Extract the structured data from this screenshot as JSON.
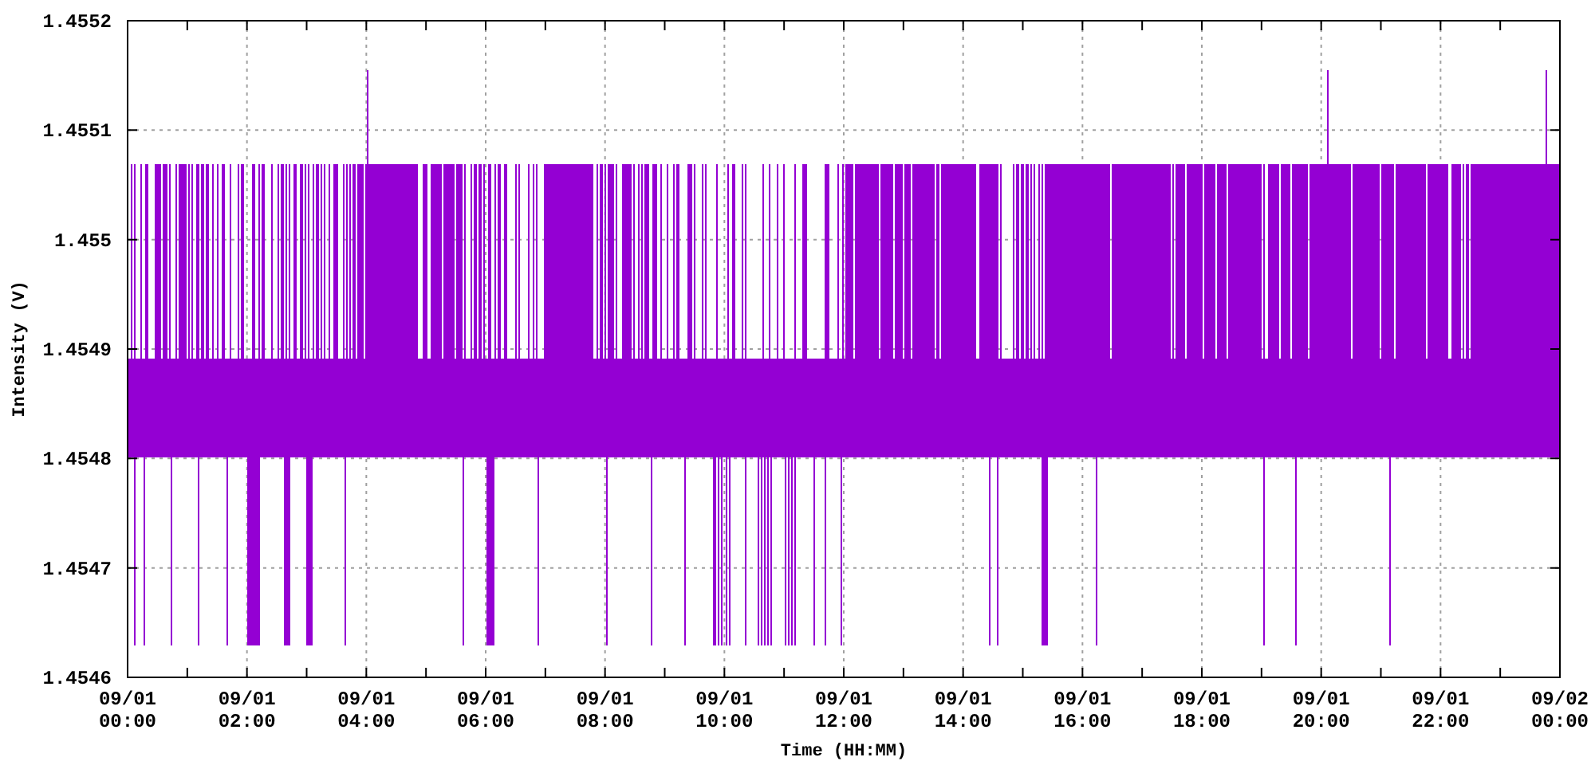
{
  "chart": {
    "y_axis": {
      "label": "Intensity (V)",
      "ticks": [
        "1.4552",
        "1.4551",
        "1.455",
        "1.4549",
        "1.4548",
        "1.4547",
        "1.4546"
      ]
    },
    "x_axis": {
      "label": "Time (HH:MM)",
      "ticks": [
        {
          "date": "09/01",
          "time": "00:00"
        },
        {
          "date": "09/01",
          "time": "02:00"
        },
        {
          "date": "09/01",
          "time": "04:00"
        },
        {
          "date": "09/01",
          "time": "06:00"
        },
        {
          "date": "09/01",
          "time": "08:00"
        },
        {
          "date": "09/01",
          "time": "10:00"
        },
        {
          "date": "09/01",
          "time": "12:00"
        },
        {
          "date": "09/01",
          "time": "14:00"
        },
        {
          "date": "09/01",
          "time": "16:00"
        },
        {
          "date": "09/01",
          "time": "18:00"
        },
        {
          "date": "09/01",
          "time": "20:00"
        },
        {
          "date": "09/01",
          "time": "22:00"
        },
        {
          "date": "09/02",
          "time": "00:00"
        }
      ]
    }
  }
}
